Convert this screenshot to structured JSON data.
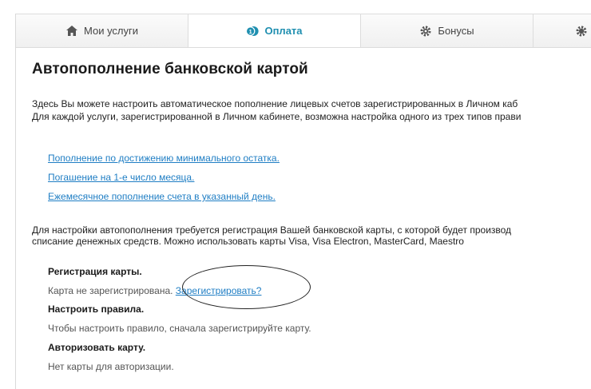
{
  "tabs": [
    {
      "label": "Мои услуги",
      "icon": "home-icon"
    },
    {
      "label": "Оплата",
      "icon": "payment-icon"
    },
    {
      "label": "Бонусы",
      "icon": "gear-icon"
    },
    {
      "label": "",
      "icon": "gear-icon"
    }
  ],
  "colors": {
    "accent": "#1f8fb0",
    "link": "#1f7ec4"
  },
  "page": {
    "title": "Автопополнение банковской картой",
    "intro_line1": "Здесь Вы можете настроить автоматическое пополнение лицевых счетов зарегистрированных в Личном каб",
    "intro_line2": "Для каждой услуги, зарегистрированной в Личном кабинете, возможна настройка одного из трех типов прави",
    "links": [
      "Пополнение по достижению минимального остатка.",
      "Погашение на 1-е число месяца.",
      "Ежемесячное пополнение счета в указанный день."
    ],
    "note_line1": "Для настройки автопополнения требуется регистрация Вашей банковской карты, с которой будет производ",
    "note_line2": "списание денежных средств. Можно использовать карты Visa, Visa Electron, MasterCard, Maestro"
  },
  "registration": {
    "heading": "Регистрация карты.",
    "status": "Карта не зарегистрирована.",
    "register_link": "Зарегистрировать?"
  },
  "rules": {
    "heading": "Настроить правила.",
    "text": "Чтобы настроить правило, сначала зарегистрируйте карту."
  },
  "authorize": {
    "heading": "Авторизовать карту.",
    "text": "Нет карты для авторизации."
  }
}
